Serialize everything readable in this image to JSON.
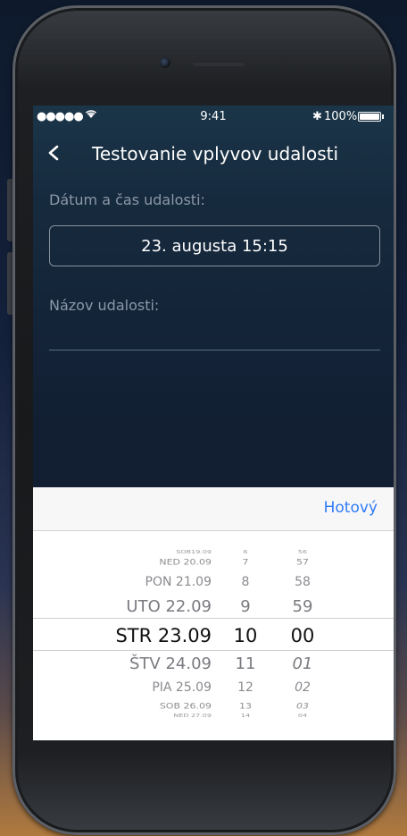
{
  "status_bar": {
    "signal": "●●●●●",
    "wifi_icon": "wifi-icon",
    "time": "9:41",
    "bluetooth": "✱",
    "battery_text": "100%"
  },
  "nav": {
    "title": "Testovanie vplyvov udalosti"
  },
  "form": {
    "date_label": "Dátum a čas udalosti:",
    "date_value": "23. augusta 15:15",
    "name_label": "Názov udalosti:",
    "name_value": ""
  },
  "picker": {
    "done_label": "Hotový",
    "days": [
      "SOB19.09",
      "NED 20.09",
      "PON 21.09",
      "UTO 22.09",
      "STR 23.09",
      "ŠTV 24.09",
      "PIA 25.09",
      "SOB 26.09",
      "NED 27.09"
    ],
    "hours": [
      "6",
      "7",
      "8",
      "9",
      "10",
      "11",
      "12",
      "13",
      "14"
    ],
    "minutes": [
      "56",
      "57",
      "58",
      "59",
      "00",
      "01",
      "02",
      "03",
      "04"
    ]
  }
}
